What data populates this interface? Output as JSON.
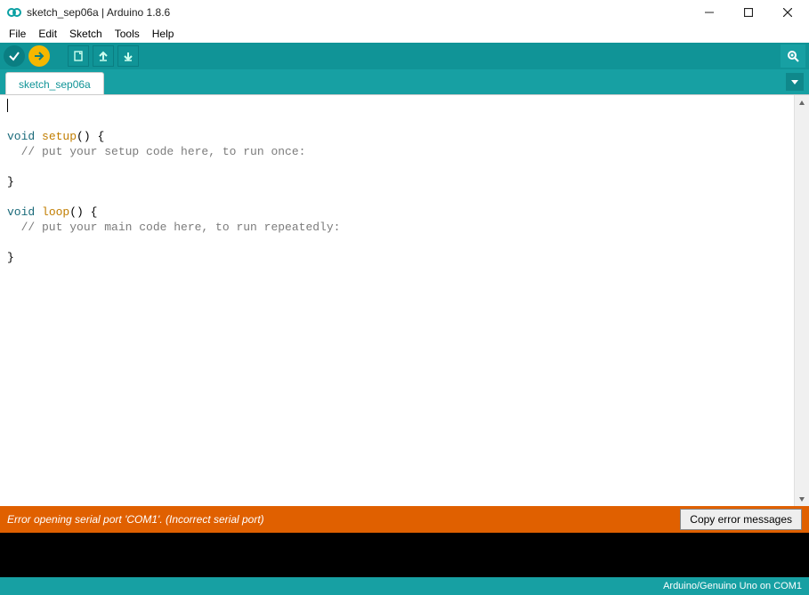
{
  "titlebar": {
    "title": "sketch_sep06a | Arduino 1.8.6"
  },
  "menu": {
    "file": "File",
    "edit": "Edit",
    "sketch": "Sketch",
    "tools": "Tools",
    "help": "Help"
  },
  "toolbar": {
    "verify": "verify",
    "upload": "upload",
    "new": "new",
    "open": "open",
    "save": "save",
    "serial_monitor": "serial-monitor"
  },
  "tabs": {
    "active": "sketch_sep06a"
  },
  "code": {
    "l1_kw": "void",
    "l1_fn": "setup",
    "l1_rest": "() {",
    "l2": "  // put your setup code here, to run once:",
    "l3": "",
    "l4": "}",
    "l5": "",
    "l6_kw": "void",
    "l6_fn": "loop",
    "l6_rest": "() {",
    "l7": "  // put your main code here, to run repeatedly:",
    "l8": "",
    "l9": "}"
  },
  "error": {
    "message": "Error opening serial port 'COM1'. (Incorrect serial port)",
    "copy_label": "Copy error messages"
  },
  "footer": {
    "board": "Arduino/Genuino Uno on COM1"
  }
}
